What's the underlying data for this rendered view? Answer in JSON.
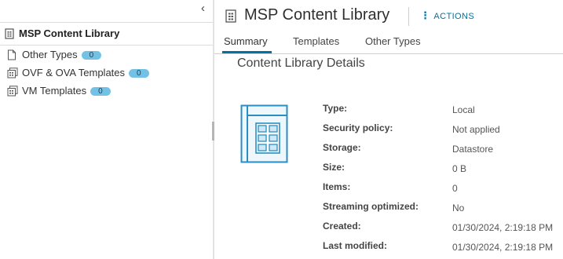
{
  "sidebar": {
    "header_label": "MSP Content Library",
    "items": [
      {
        "label": "Other Types",
        "count": "0",
        "icon": "file-icon"
      },
      {
        "label": "OVF & OVA Templates",
        "count": "0",
        "icon": "template-stack-icon"
      },
      {
        "label": "VM Templates",
        "count": "0",
        "icon": "template-stack-icon"
      }
    ]
  },
  "header": {
    "title": "MSP Content Library",
    "actions_label": "ACTIONS"
  },
  "tabs": [
    {
      "label": "Summary",
      "active": true
    },
    {
      "label": "Templates",
      "active": false
    },
    {
      "label": "Other Types",
      "active": false
    }
  ],
  "details": {
    "section_title": "Content Library Details",
    "rows": [
      {
        "label": "Type:",
        "value": "Local"
      },
      {
        "label": "Security policy:",
        "value": "Not applied"
      },
      {
        "label": "Storage:",
        "value": "Datastore"
      },
      {
        "label": "Size:",
        "value": "0 B"
      },
      {
        "label": "Items:",
        "value": "0"
      },
      {
        "label": "Streaming optimized:",
        "value": "No"
      },
      {
        "label": "Created:",
        "value": "01/30/2024, 2:19:18 PM"
      },
      {
        "label": "Last modified:",
        "value": "01/30/2024, 2:19:18 PM"
      }
    ]
  },
  "colors": {
    "accent": "#0072a3",
    "badge": "#74c1e6",
    "library_icon": "#2a8ec4"
  }
}
